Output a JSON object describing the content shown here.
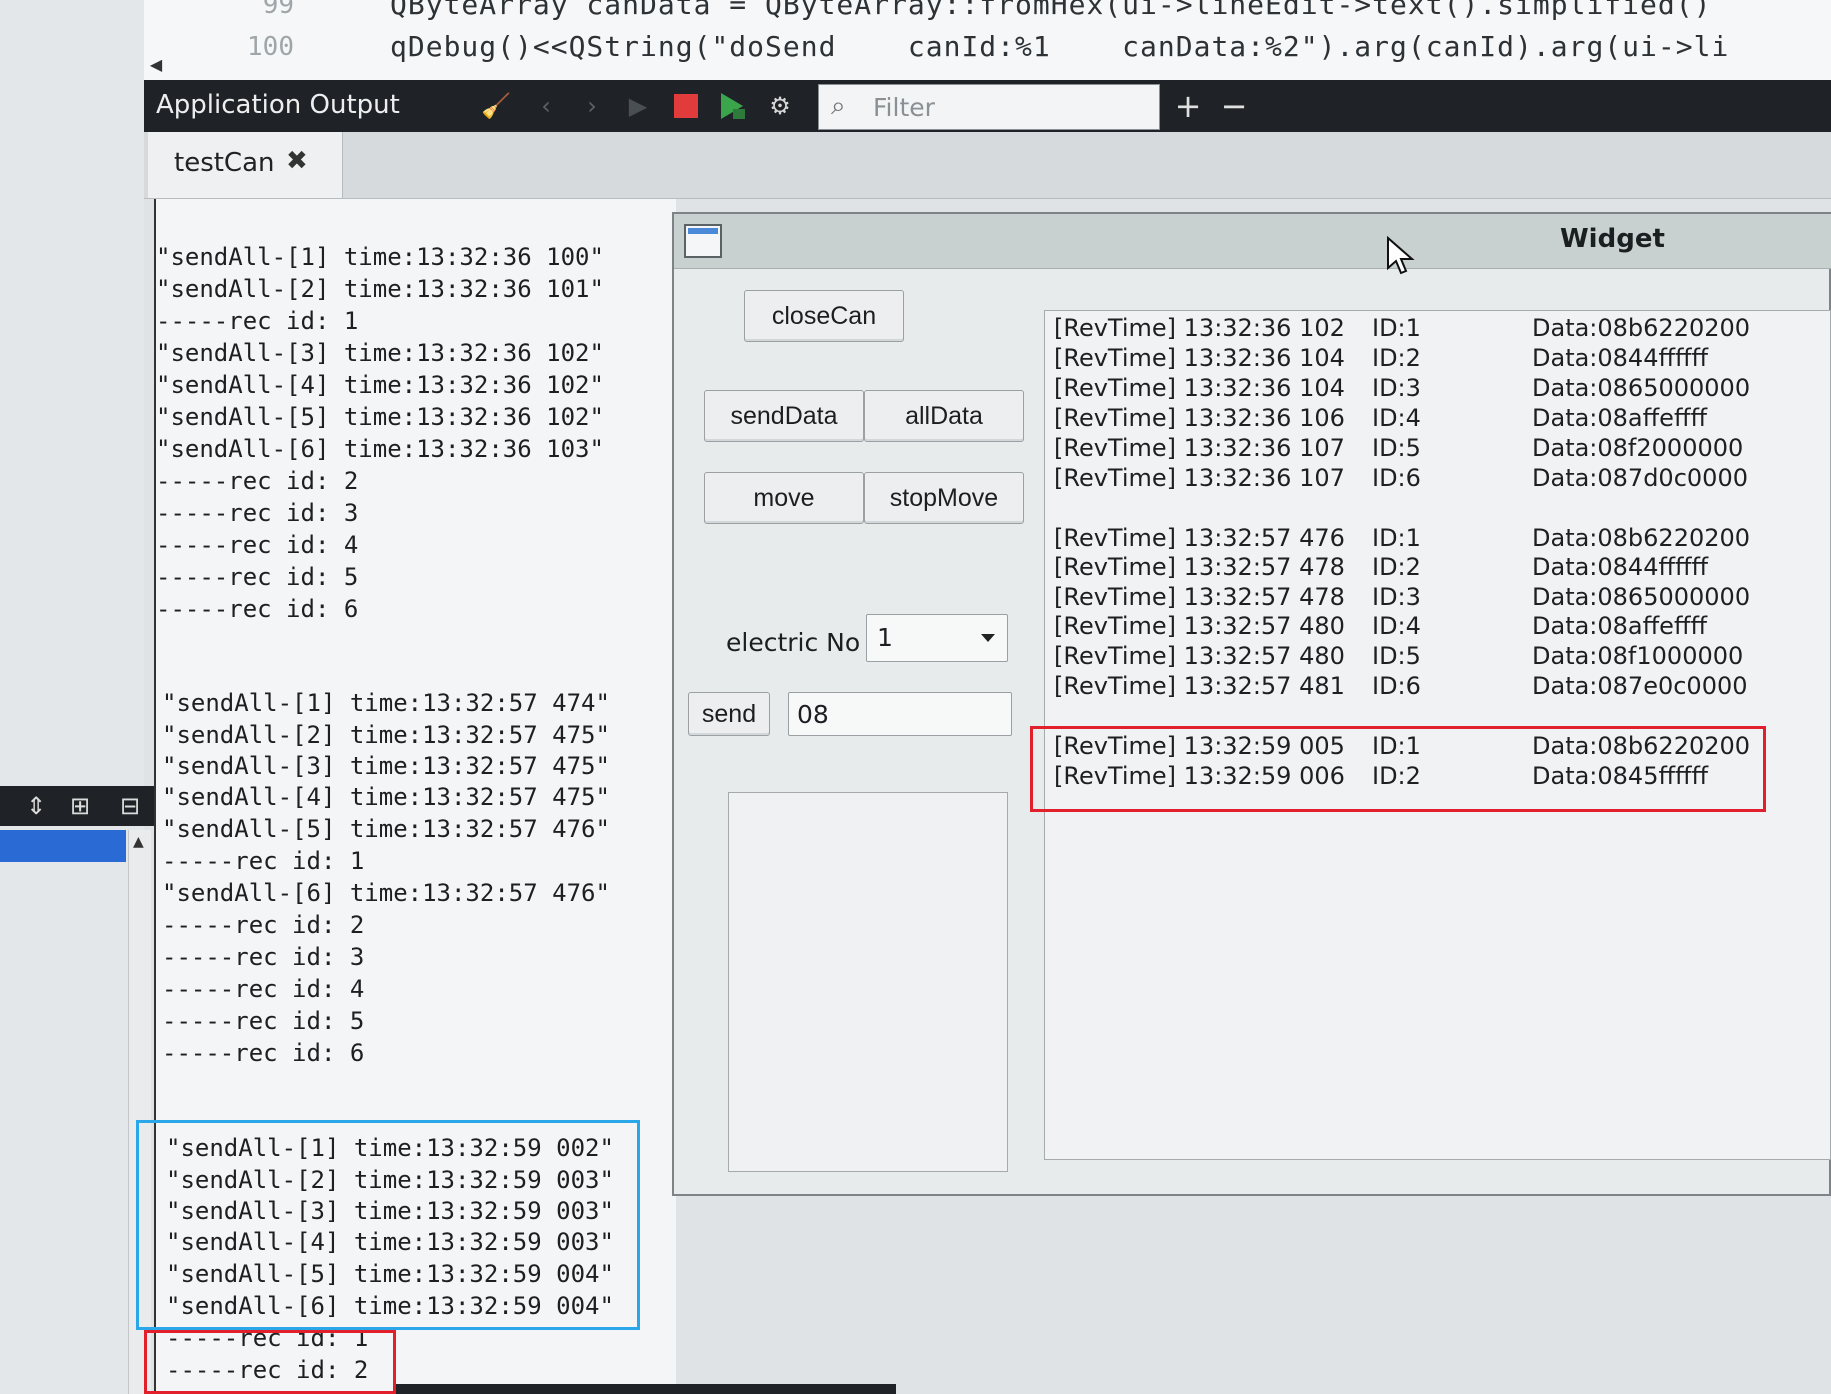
{
  "editor": {
    "lines": [
      {
        "num": "99",
        "code": "QByteArray canData = QByteArray::fromHex(ui->lineEdit->text().simplified()"
      },
      {
        "num": "100",
        "code": "qDebug()<<QString(\"doSend    canId:%1    canData:%2\").arg(canId).arg(ui->li"
      }
    ]
  },
  "output_panel": {
    "title": "Application Output",
    "filter_placeholder": "Filter",
    "icons": [
      "clean-icon",
      "prev-icon",
      "next-icon",
      "run-icon",
      "stop-icon",
      "debug-run-icon",
      "settings-icon",
      "search-icon",
      "zoom-in-icon",
      "zoom-out-icon"
    ],
    "tab_label": "testCan"
  },
  "console_lines": [
    "\"sendAll-[1] time:13:32:36 100\"",
    "\"sendAll-[2] time:13:32:36 101\"",
    "-----rec id: 1",
    "\"sendAll-[3] time:13:32:36 102\"",
    "\"sendAll-[4] time:13:32:36 102\"",
    "\"sendAll-[5] time:13:32:36 102\"",
    "\"sendAll-[6] time:13:32:36 103\"",
    "-----rec id: 2",
    "-----rec id: 3",
    "-----rec id: 4",
    "-----rec id: 5",
    "-----rec id: 6",
    "\"sendAll-[1] time:13:32:57 474\"",
    "\"sendAll-[2] time:13:32:57 475\"",
    "\"sendAll-[3] time:13:32:57 475\"",
    "\"sendAll-[4] time:13:32:57 475\"",
    "\"sendAll-[5] time:13:32:57 476\"",
    "-----rec id: 1",
    "\"sendAll-[6] time:13:32:57 476\"",
    "-----rec id: 2",
    "-----rec id: 3",
    "-----rec id: 4",
    "-----rec id: 5",
    "-----rec id: 6",
    "\"sendAll-[1] time:13:32:59 002\"",
    "\"sendAll-[2] time:13:32:59 003\"",
    "\"sendAll-[3] time:13:32:59 003\"",
    "\"sendAll-[4] time:13:32:59 003\"",
    "\"sendAll-[5] time:13:32:59 004\"",
    "\"sendAll-[6] time:13:32:59 004\"",
    "-----rec id: 1",
    "-----rec id: 2"
  ],
  "widget": {
    "title": "Widget",
    "buttons": {
      "close_can": "closeCan",
      "send_data": "sendData",
      "all_data": "allData",
      "move": "move",
      "stop_move": "stopMove",
      "send": "send"
    },
    "electric_label": "electric No",
    "electric_value": "1",
    "send_value": "08",
    "received": [
      {
        "time": "[RevTime] 13:32:36 102",
        "id": "ID:1",
        "data": "Data:08b6220200"
      },
      {
        "time": "[RevTime] 13:32:36 104",
        "id": "ID:2",
        "data": "Data:0844ffffff"
      },
      {
        "time": "[RevTime] 13:32:36 104",
        "id": "ID:3",
        "data": "Data:0865000000"
      },
      {
        "time": "[RevTime] 13:32:36 106",
        "id": "ID:4",
        "data": "Data:08affeffff"
      },
      {
        "time": "[RevTime] 13:32:36 107",
        "id": "ID:5",
        "data": "Data:08f2000000"
      },
      {
        "time": "[RevTime] 13:32:36 107",
        "id": "ID:6",
        "data": "Data:087d0c0000"
      },
      {
        "time": "[RevTime] 13:32:57 476",
        "id": "ID:1",
        "data": "Data:08b6220200"
      },
      {
        "time": "[RevTime] 13:32:57 478",
        "id": "ID:2",
        "data": "Data:0844ffffff"
      },
      {
        "time": "[RevTime] 13:32:57 478",
        "id": "ID:3",
        "data": "Data:0865000000"
      },
      {
        "time": "[RevTime] 13:32:57 480",
        "id": "ID:4",
        "data": "Data:08affeffff"
      },
      {
        "time": "[RevTime] 13:32:57 480",
        "id": "ID:5",
        "data": "Data:08f1000000"
      },
      {
        "time": "[RevTime] 13:32:57 481",
        "id": "ID:6",
        "data": "Data:087e0c0000"
      },
      {
        "time": "[RevTime] 13:32:59 005",
        "id": "ID:1",
        "data": "Data:08b6220200"
      },
      {
        "time": "[RevTime] 13:32:59 006",
        "id": "ID:2",
        "data": "Data:0845ffffff"
      }
    ]
  },
  "colors": {
    "toolbar_bg": "#1f2327",
    "highlight_blue": "#2aa7e8",
    "highlight_red": "#e2202b",
    "stop_red": "#e23b3b",
    "run_green": "#3aa54a"
  }
}
